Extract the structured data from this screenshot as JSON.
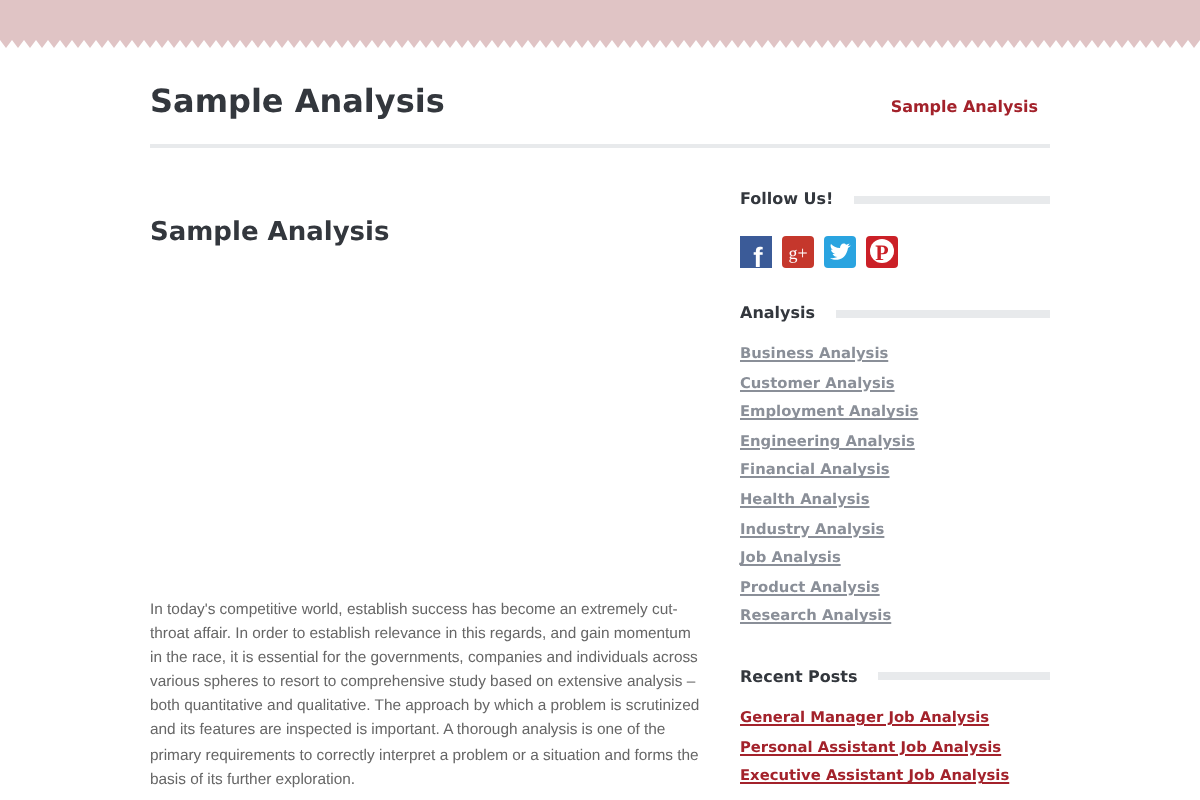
{
  "site": {
    "title": "Sample Analysis",
    "nav": [
      "Sample Analysis"
    ]
  },
  "article": {
    "title": "Sample Analysis",
    "body": "In today's competitive world, establish success has become an extremely cut-throat affair. In order to establish relevance in this regards, and gain momentum in the race, it is essential for the governments, companies and individuals across various spheres to resort to comprehensive study based on extensive analysis – both quantitative and qualitative. The approach by which a problem is scrutinized and its features are inspected is important. A thorough analysis is one of the primary requirements to correctly interpret a problem or a situation and forms the basis of its further exploration."
  },
  "sidebar": [
    {
      "kind": "social",
      "title": "Follow Us!",
      "icons": [
        {
          "kind": "facebook",
          "glyph": "f"
        },
        {
          "kind": "googleplus",
          "glyph": "g+"
        },
        {
          "kind": "twitter"
        },
        {
          "kind": "pinterest",
          "glyph": "P"
        }
      ]
    },
    {
      "kind": "categories",
      "title": "Analysis",
      "links": [
        "Business Analysis",
        "Customer Analysis",
        "Employment Analysis",
        "Engineering Analysis",
        "Financial Analysis",
        "Health Analysis",
        "Industry Analysis",
        "Job Analysis",
        "Product Analysis",
        "Research Analysis"
      ]
    },
    {
      "kind": "posts",
      "title": "Recent Posts",
      "links": [
        "General Manager Job Analysis",
        "Personal Assistant Job Analysis",
        "Executive Assistant Job Analysis"
      ]
    }
  ]
}
